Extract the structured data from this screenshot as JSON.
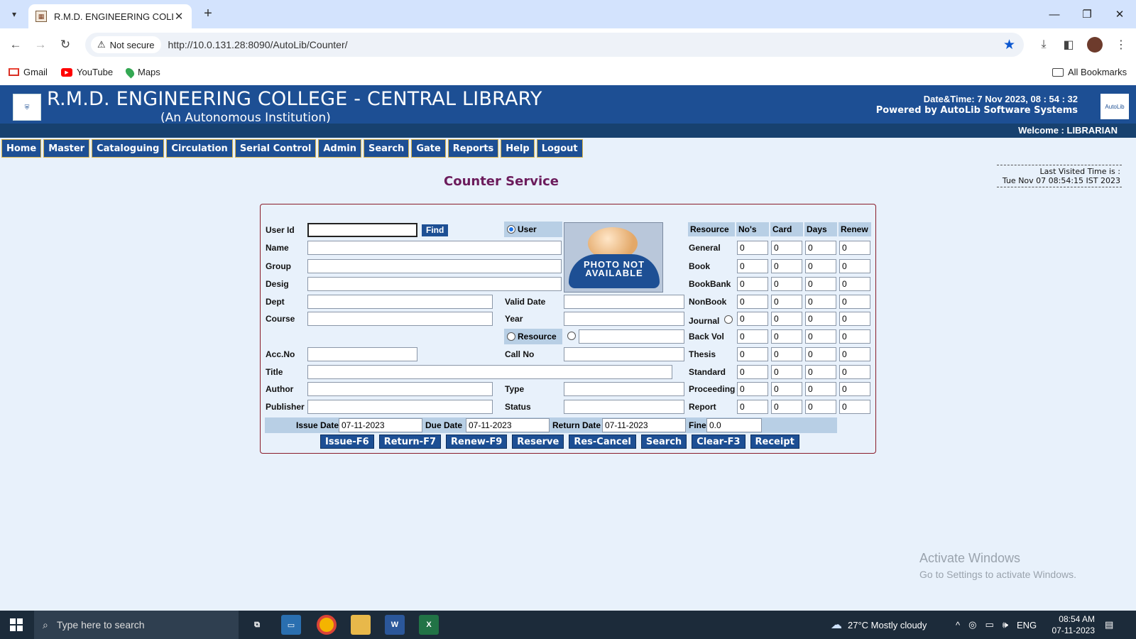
{
  "browser": {
    "tab_title": "R.M.D. ENGINEERING COLLEGE",
    "security": "Not secure",
    "url": "http://10.0.131.28:8090/AutoLib/Counter/",
    "bookmarks": [
      "Gmail",
      "YouTube",
      "Maps"
    ],
    "all_bookmarks": "All Bookmarks"
  },
  "header": {
    "college": "R.M.D. ENGINEERING COLLEGE - CENTRAL LIBRARY",
    "subtitle": "(An Autonomous Institution)",
    "datetime": "Date&Time:  7 Nov 2023, 08 : 54 : 32",
    "powered": "Powered by AutoLib Software Systems",
    "welcome": "Welcome   :  LIBRARIAN",
    "right_logo": "AutoLib"
  },
  "menu": [
    "Home",
    "Master",
    "Cataloguing",
    "Circulation",
    "Serial Control",
    "Admin",
    "Search",
    "Gate",
    "Reports",
    "Help",
    "Logout"
  ],
  "page": {
    "title": "Counter Service",
    "last_visited_label": "Last Visited Time is :",
    "last_visited_value": "Tue Nov 07 08:54:15 IST 2023"
  },
  "form": {
    "labels": {
      "user_id": "User Id",
      "name": "Name",
      "group": "Group",
      "desig": "Desig",
      "dept": "Dept",
      "course": "Course",
      "acc_no": "Acc.No",
      "title": "Title",
      "author": "Author",
      "publisher": "Publisher",
      "valid_date": "Valid Date",
      "year": "Year",
      "call_no": "Call No",
      "type": "Type",
      "status": "Status"
    },
    "find_label": "Find",
    "radio_user": "User",
    "radio_resource": "Resource",
    "photo_text": "PHOTO NOT AVAILABLE"
  },
  "resource_table": {
    "headers": [
      "Resource",
      "No's",
      "Card",
      "Days",
      "Renew"
    ],
    "rows": [
      {
        "name": "General",
        "values": [
          "0",
          "0",
          "0",
          "0"
        ]
      },
      {
        "name": "Book",
        "values": [
          "0",
          "0",
          "0",
          "0"
        ]
      },
      {
        "name": "BookBank",
        "values": [
          "0",
          "0",
          "0",
          "0"
        ]
      },
      {
        "name": "NonBook",
        "values": [
          "0",
          "0",
          "0",
          "0"
        ]
      },
      {
        "name": "Journal",
        "values": [
          "0",
          "0",
          "0",
          "0"
        ]
      },
      {
        "name": "Back Vol",
        "values": [
          "0",
          "0",
          "0",
          "0"
        ]
      },
      {
        "name": "Thesis",
        "values": [
          "0",
          "0",
          "0",
          "0"
        ]
      },
      {
        "name": "Standard",
        "values": [
          "0",
          "0",
          "0",
          "0"
        ]
      },
      {
        "name": "Proceeding",
        "values": [
          "0",
          "0",
          "0",
          "0"
        ]
      },
      {
        "name": "Report",
        "values": [
          "0",
          "0",
          "0",
          "0"
        ]
      }
    ]
  },
  "dates": {
    "issue_label": "Issue Date",
    "issue_value": "07-11-2023",
    "due_label": "Due Date",
    "due_value": "07-11-2023",
    "return_label": "Return Date",
    "return_value": "07-11-2023",
    "fine_label": "Fine",
    "fine_value": "0.0"
  },
  "actions": [
    "Issue-F6",
    "Return-F7",
    "Renew-F9",
    "Reserve",
    "Res-Cancel",
    "Search",
    "Clear-F3",
    "Receipt"
  ],
  "watermark": {
    "line1": "Activate Windows",
    "line2": "Go to Settings to activate Windows."
  },
  "taskbar": {
    "search_placeholder": "Type here to search",
    "weather": "27°C  Mostly cloudy",
    "lang": "ENG",
    "time": "08:54 AM",
    "date": "07-11-2023"
  },
  "colors": {
    "banner": "#1d4f94",
    "title": "#6c1c5c",
    "panel_border": "#8a1c2a",
    "page_bg": "#e8f1fb"
  }
}
